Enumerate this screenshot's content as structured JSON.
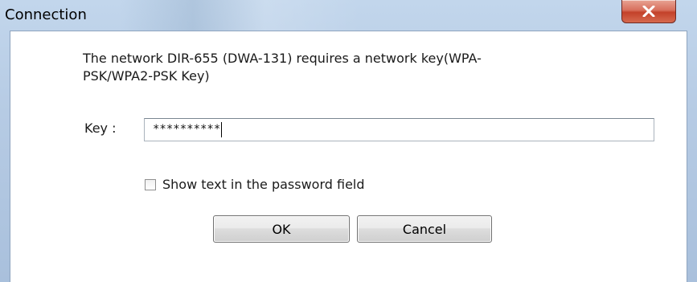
{
  "window": {
    "title": "Connection"
  },
  "dialog": {
    "message": "The network DIR-655 (DWA-131) requires a network key(WPA-PSK/WPA2-PSK Key)",
    "key_label": "Key :",
    "key_value": "**********",
    "show_text_label": "Show text in the password field",
    "show_text_checked": false,
    "ok_label": "OK",
    "cancel_label": "Cancel"
  },
  "icons": {
    "close": "close-icon"
  },
  "colors": {
    "close_button": "#c3412a",
    "frame": "#b6cbe4"
  }
}
